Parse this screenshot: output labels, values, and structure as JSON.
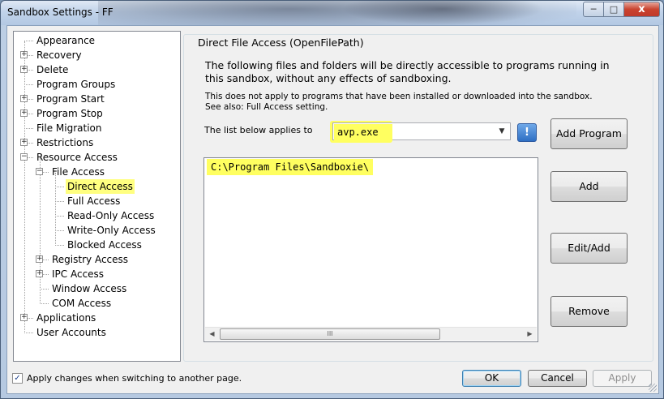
{
  "window": {
    "title": "Sandbox Settings - FF",
    "minimize_label": "─",
    "maximize_label": "□",
    "close_label": "x"
  },
  "tree": {
    "items": [
      {
        "label": "Appearance",
        "expandable": false,
        "selected": false
      },
      {
        "label": "Recovery",
        "expandable": true,
        "selected": false
      },
      {
        "label": "Delete",
        "expandable": true,
        "selected": false
      },
      {
        "label": "Program Groups",
        "expandable": false,
        "selected": false
      },
      {
        "label": "Program Start",
        "expandable": true,
        "selected": false
      },
      {
        "label": "Program Stop",
        "expandable": true,
        "selected": false
      },
      {
        "label": "File Migration",
        "expandable": false,
        "selected": false
      },
      {
        "label": "Restrictions",
        "expandable": true,
        "selected": false
      },
      {
        "label": "Resource Access",
        "expandable": true,
        "expanded": true,
        "selected": false
      },
      {
        "label": "File Access",
        "expandable": true,
        "expanded": true,
        "selected": false
      },
      {
        "label": "Direct Access",
        "expandable": false,
        "selected": true
      },
      {
        "label": "Full Access",
        "expandable": false,
        "selected": false
      },
      {
        "label": "Read-Only Access",
        "expandable": false,
        "selected": false
      },
      {
        "label": "Write-Only Access",
        "expandable": false,
        "selected": false
      },
      {
        "label": "Blocked Access",
        "expandable": false,
        "selected": false
      },
      {
        "label": "Registry Access",
        "expandable": true,
        "selected": false
      },
      {
        "label": "IPC Access",
        "expandable": true,
        "selected": false
      },
      {
        "label": "Window Access",
        "expandable": false,
        "selected": false
      },
      {
        "label": "COM Access",
        "expandable": false,
        "selected": false
      },
      {
        "label": "Applications",
        "expandable": true,
        "selected": false
      },
      {
        "label": "User Accounts",
        "expandable": false,
        "selected": false
      }
    ]
  },
  "panel": {
    "group_title": "Direct File Access (OpenFilePath)",
    "description": "The following files and folders will be directly accessible to programs running in this sandbox, without any effects of sandboxing.",
    "note_line1": "This does not apply to programs that have been installed or downloaded into the sandbox.",
    "note_line2": "See also:  Full Access setting.",
    "applies_label": "The list below applies to",
    "program_select": "avp.exe",
    "info_button": "!",
    "paths": [
      "C:\\Program Files\\Sandboxie\\"
    ],
    "scroll_left": "◀",
    "scroll_right": "▶",
    "scroll_grip": "III"
  },
  "buttons": {
    "add_program": "Add Program",
    "add": "Add",
    "edit_add": "Edit/Add",
    "remove": "Remove"
  },
  "footer": {
    "apply_on_switch_label": "Apply changes when switching to another page.",
    "apply_on_switch_checked": true,
    "checkmark": "✓",
    "ok": "OK",
    "cancel": "Cancel",
    "apply": "Apply"
  },
  "colors": {
    "highlight": "#ffff60",
    "selection": "#ffff80"
  }
}
